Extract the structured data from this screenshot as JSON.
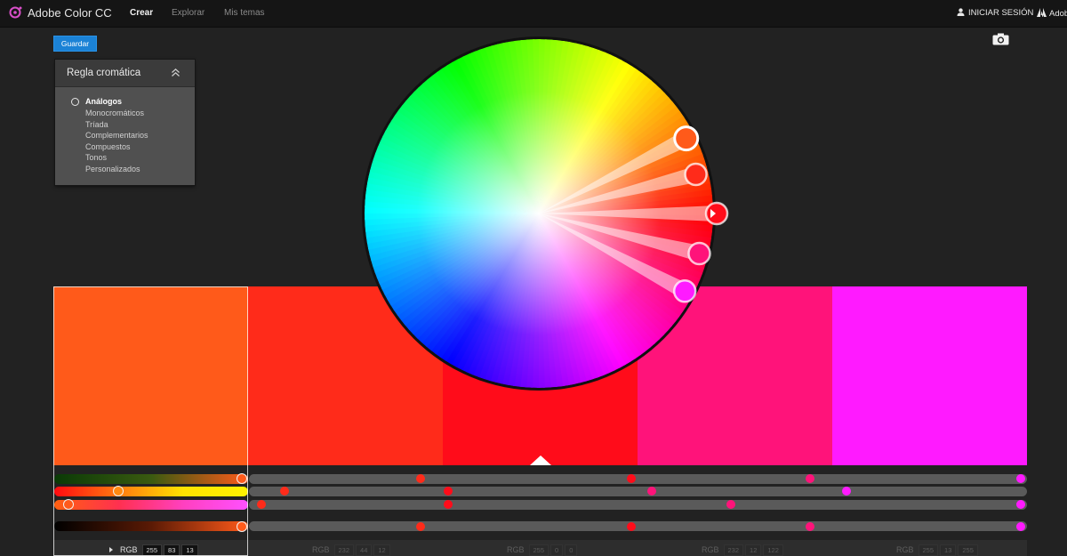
{
  "header": {
    "app_title": "Adobe Color CC",
    "nav": [
      "Crear",
      "Explorar",
      "Mis temas"
    ],
    "active_nav": "Crear",
    "signin_label": "INICIAR SESIÓN",
    "adobe_label": "Adob"
  },
  "toolbar": {
    "save_label": "Guardar"
  },
  "rule_panel": {
    "title": "Regla cromática",
    "options": [
      "Análogos",
      "Monocromáticos",
      "Tríada",
      "Complementarios",
      "Compuestos",
      "Tonos",
      "Personalizados"
    ],
    "selected": "Análogos"
  },
  "colors": {
    "accent": "#1b82d6",
    "swatches": [
      "#ff5a1a",
      "#ff2b1a",
      "#ff0c1a",
      "#ff137a",
      "#ff1aff"
    ]
  },
  "swatches": [
    {
      "rgb": [
        255,
        83,
        13
      ]
    },
    {
      "rgb": [
        232,
        44,
        12
      ]
    },
    {
      "rgb": [
        255,
        0,
        0
      ]
    },
    {
      "rgb": [
        232,
        12,
        122
      ]
    },
    {
      "rgb": [
        255,
        13,
        255
      ]
    }
  ],
  "active_swatch": 0,
  "rgb_mode_label": "RGB",
  "icons": {
    "logo": "adobe-color-logo-icon",
    "user": "user-icon",
    "adobe": "adobe-logo-icon",
    "camera": "camera-icon",
    "collapse": "chevron-up-double-icon",
    "radio": "radio-icon"
  }
}
